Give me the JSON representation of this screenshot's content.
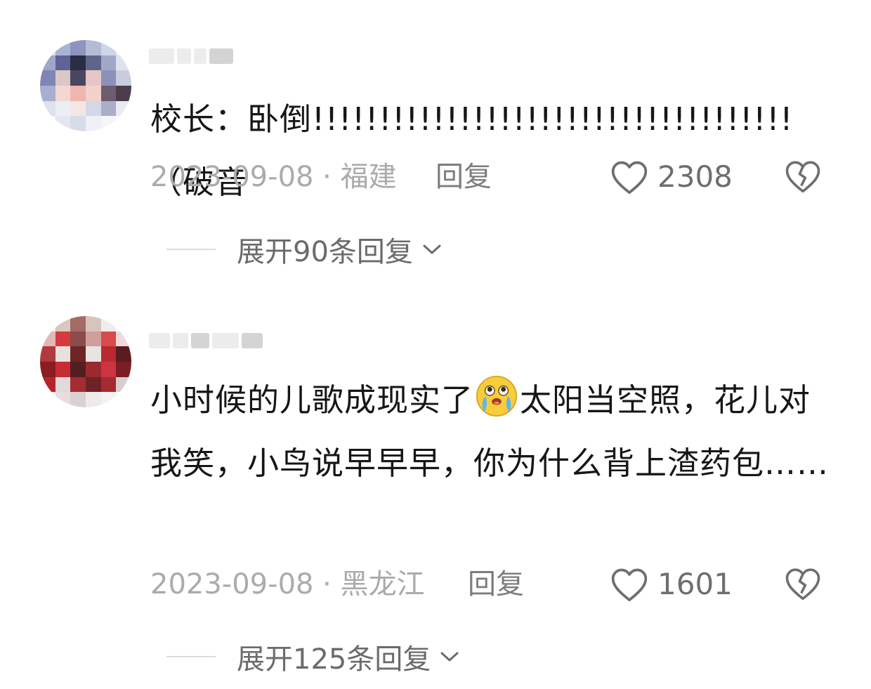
{
  "comments": [
    {
      "text": "校长：卧倒!!!!!!!!!!!!!!!!!!!!!!!!!!!!!!!!!!!!（破音",
      "date_location": "2023-09-08 · 福建",
      "reply_label": "回复",
      "likes": "2308",
      "expand_label": "展开90条回复"
    },
    {
      "text_part1": "小时候的儿歌成现实了",
      "emoji": "crying-face-emoji",
      "text_part2": "太阳当空照，花儿对我笑，小鸟说早早早，你为什么背上渣药包……",
      "date_location": "2023-09-08 · 黑龙江",
      "reply_label": "回复",
      "likes": "1601",
      "expand_label": "展开125条回复"
    }
  ],
  "icons": {
    "like": "heart-outline-icon",
    "dislike": "broken-heart-icon",
    "expand": "chevron-down-icon"
  },
  "colors": {
    "text": "#161616",
    "meta": "#ababab",
    "reply": "#7d7d7d",
    "icon": "#6e6e6e"
  }
}
